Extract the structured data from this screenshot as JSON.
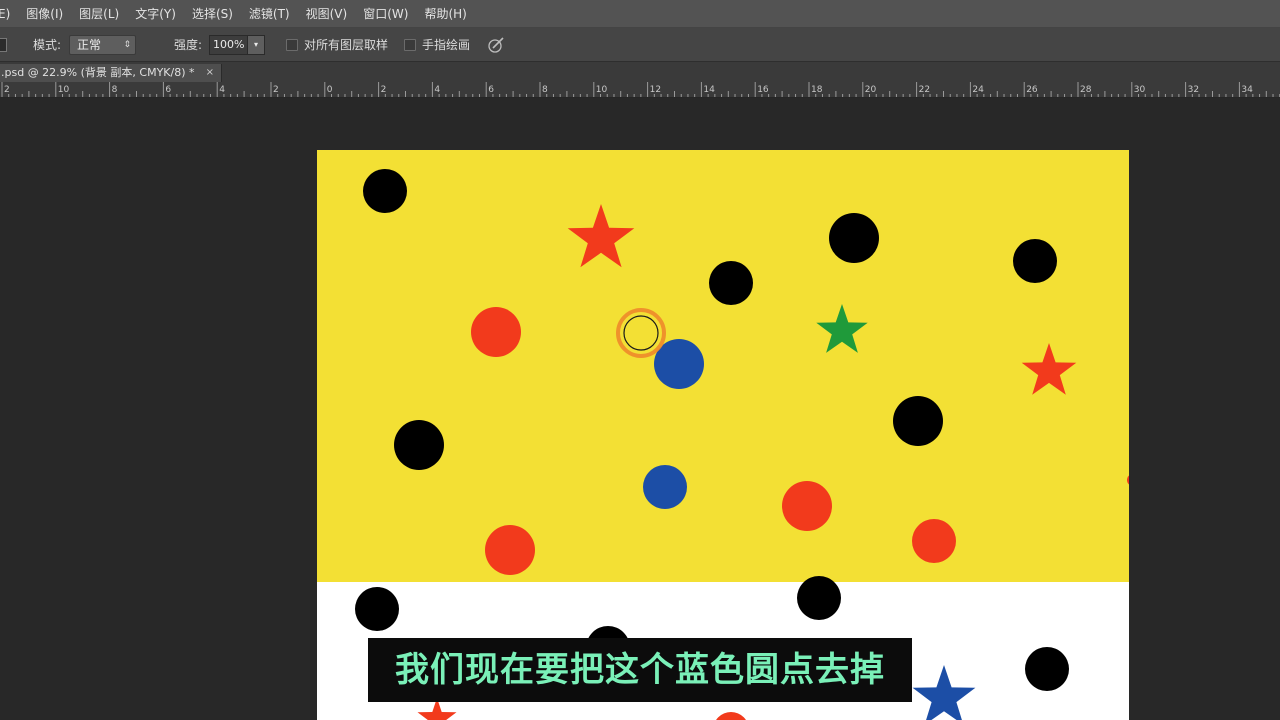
{
  "menubar": {
    "items": [
      "E)",
      "图像(I)",
      "图层(L)",
      "文字(Y)",
      "选择(S)",
      "滤镜(T)",
      "视图(V)",
      "窗口(W)",
      "帮助(H)"
    ]
  },
  "options": {
    "mode_label": "模式:",
    "mode_value": "正常",
    "strength_label": "强度:",
    "strength_value": "100%",
    "sample_all_layers": "对所有图层取样",
    "finger_painting": "手指绘画",
    "tool_icon": "smudge-tool-icon",
    "pressure_icon": "pen-pressure-icon"
  },
  "tab": {
    "title": ".psd @ 22.9% (背景 副本, CMYK/8) *",
    "close": "×"
  },
  "ruler": {
    "labels": [
      "2",
      "10",
      "8",
      "6",
      "4",
      "2",
      "0",
      "2",
      "4",
      "6",
      "8",
      "10",
      "12",
      "14",
      "16",
      "18",
      "20",
      "22",
      "24",
      "26",
      "28",
      "30",
      "32",
      "34"
    ]
  },
  "canvas": {
    "colors": {
      "yellow": "#f3e034",
      "white": "#ffffff",
      "black": "#000000",
      "red": "#f23a1c",
      "blue": "#1c4ea6",
      "green": "#1f9a3a",
      "brush_ring": "#ee8a2a"
    }
  },
  "subtitle": "我们现在要把这个蓝色圆点去掉"
}
